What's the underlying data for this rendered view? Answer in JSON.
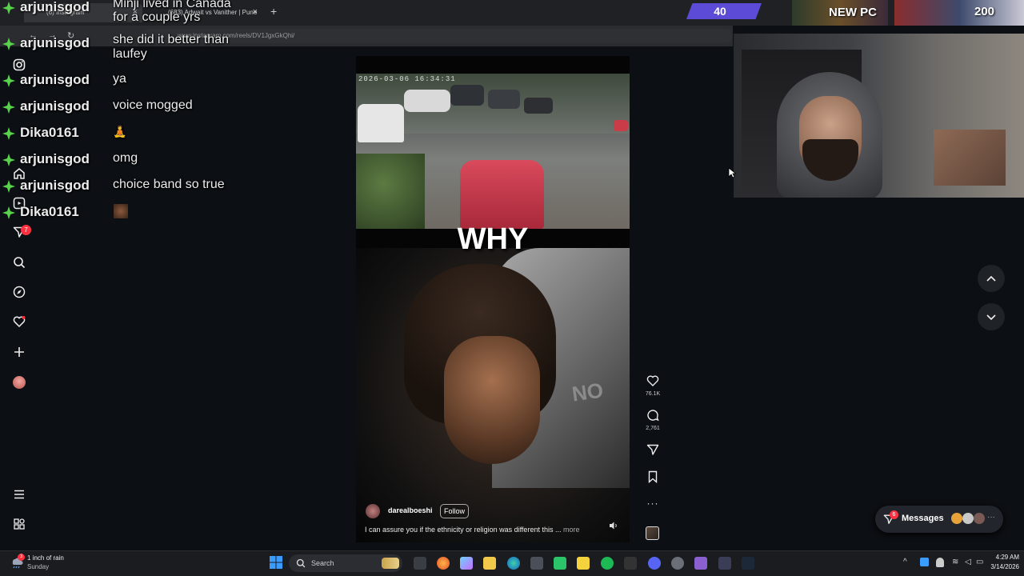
{
  "browser": {
    "tabs": [
      {
        "label": "(6) Instagram"
      },
      {
        "label": "(683) Adwait vs Vanither | Pune"
      }
    ],
    "new_tab": "+",
    "url": "www.instagram.com/reels/DV1JgxGkQhi/",
    "nav": {
      "back": "←",
      "forward": "→",
      "reload": "↻"
    }
  },
  "overlay": {
    "follower_count": "40",
    "banner_text": "NEW PC",
    "goal_count": "200"
  },
  "chat": [
    {
      "user": "arjunisgod",
      "message": "Minji lived in Canada for a couple yrs"
    },
    {
      "user": "arjunisgod",
      "message": "she did it better than laufey"
    },
    {
      "user": "arjunisgod",
      "message": "ya"
    },
    {
      "user": "arjunisgod",
      "message": "voice mogged"
    },
    {
      "user": "Dika0161",
      "message": "🧘"
    },
    {
      "user": "arjunisgod",
      "message": "omg"
    },
    {
      "user": "arjunisgod",
      "message": "choice band so true"
    },
    {
      "user": "Dika0161",
      "message": ""
    }
  ],
  "instagram": {
    "notifications_badge": "7",
    "reel": {
      "timestamp": "2026-03-06 16:34:31",
      "caption_overlay": "WHY",
      "author": "darealboeshi",
      "follow_label": "Follow",
      "caption": "I can assure you if the ethnicity or religion was different this ...",
      "more_label": "more",
      "likes": "76.1K",
      "comments": "2,761"
    },
    "messages": {
      "label": "Messages",
      "badge": "6"
    }
  },
  "taskbar": {
    "weather_title": "1 inch of rain",
    "weather_sub": "Sunday",
    "weather_badge": "3",
    "search_placeholder": "Search",
    "time": "4:29 AM",
    "date": "3/14/2026"
  },
  "colors": {
    "accent_purple": "#5b4bd6",
    "chat_gem": "#59d34b",
    "badge_red": "#ff3040"
  }
}
